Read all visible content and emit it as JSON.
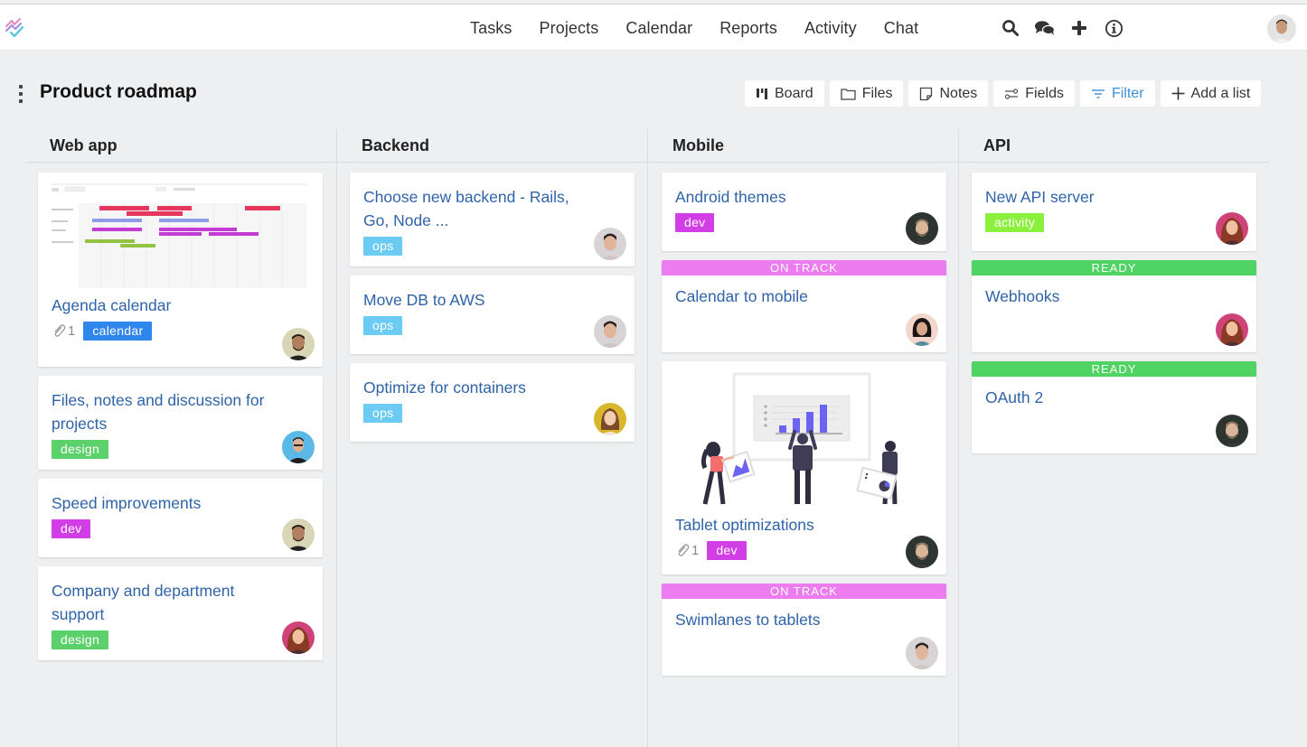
{
  "app": {
    "nav": [
      "Tasks",
      "Projects",
      "Calendar",
      "Reports",
      "Activity",
      "Chat"
    ],
    "nav_icons": [
      "search-icon",
      "chat-bubbles-icon",
      "plus-icon",
      "info-icon"
    ]
  },
  "page": {
    "title": "Product roadmap",
    "toolbar": {
      "board": "Board",
      "files": "Files",
      "notes": "Notes",
      "fields": "Fields",
      "filter": "Filter",
      "add_list": "Add a list"
    }
  },
  "colors": {
    "accent": "#3d8fd8",
    "title_link": "#2f63a8",
    "tag_calendar": "#2f86eb",
    "tag_design": "#5cd06a",
    "tag_dev": "#d23ee6",
    "tag_ops": "#6ccbf2",
    "tag_activity": "#8af03b",
    "status_on_track": "#ec7cf0",
    "status_ready": "#4fd463"
  },
  "columns": [
    {
      "name": "Web app",
      "cards": [
        {
          "title": "Agenda calendar",
          "attachments": "1",
          "tag": "calendar",
          "image": "calendar-thumbnail"
        },
        {
          "title": "Files, notes and discussion for projects",
          "tag": "design"
        },
        {
          "title": "Speed improvements",
          "tag": "dev"
        },
        {
          "title": "Company and department support",
          "tag": "design"
        }
      ]
    },
    {
      "name": "Backend",
      "cards": [
        {
          "title": "Choose new backend - Rails, Go, Node ...",
          "tag": "ops"
        },
        {
          "title": "Move DB to AWS",
          "tag": "ops"
        },
        {
          "title": "Optimize for containers",
          "tag": "ops"
        }
      ]
    },
    {
      "name": "Mobile",
      "cards": [
        {
          "title": "Android themes",
          "tag": "dev"
        },
        {
          "status": "ON TRACK",
          "title": "Calendar to mobile"
        },
        {
          "title": "Tablet optimizations",
          "attachments": "1",
          "tag": "dev",
          "image": "team-chart-illustration"
        },
        {
          "status": "ON TRACK",
          "title": "Swimlanes to tablets"
        }
      ]
    },
    {
      "name": "API",
      "cards": [
        {
          "title": "New API server",
          "tag": "activity"
        },
        {
          "status": "READY",
          "title": "Webhooks"
        },
        {
          "status": "READY",
          "title": "OAuth 2"
        }
      ]
    }
  ]
}
